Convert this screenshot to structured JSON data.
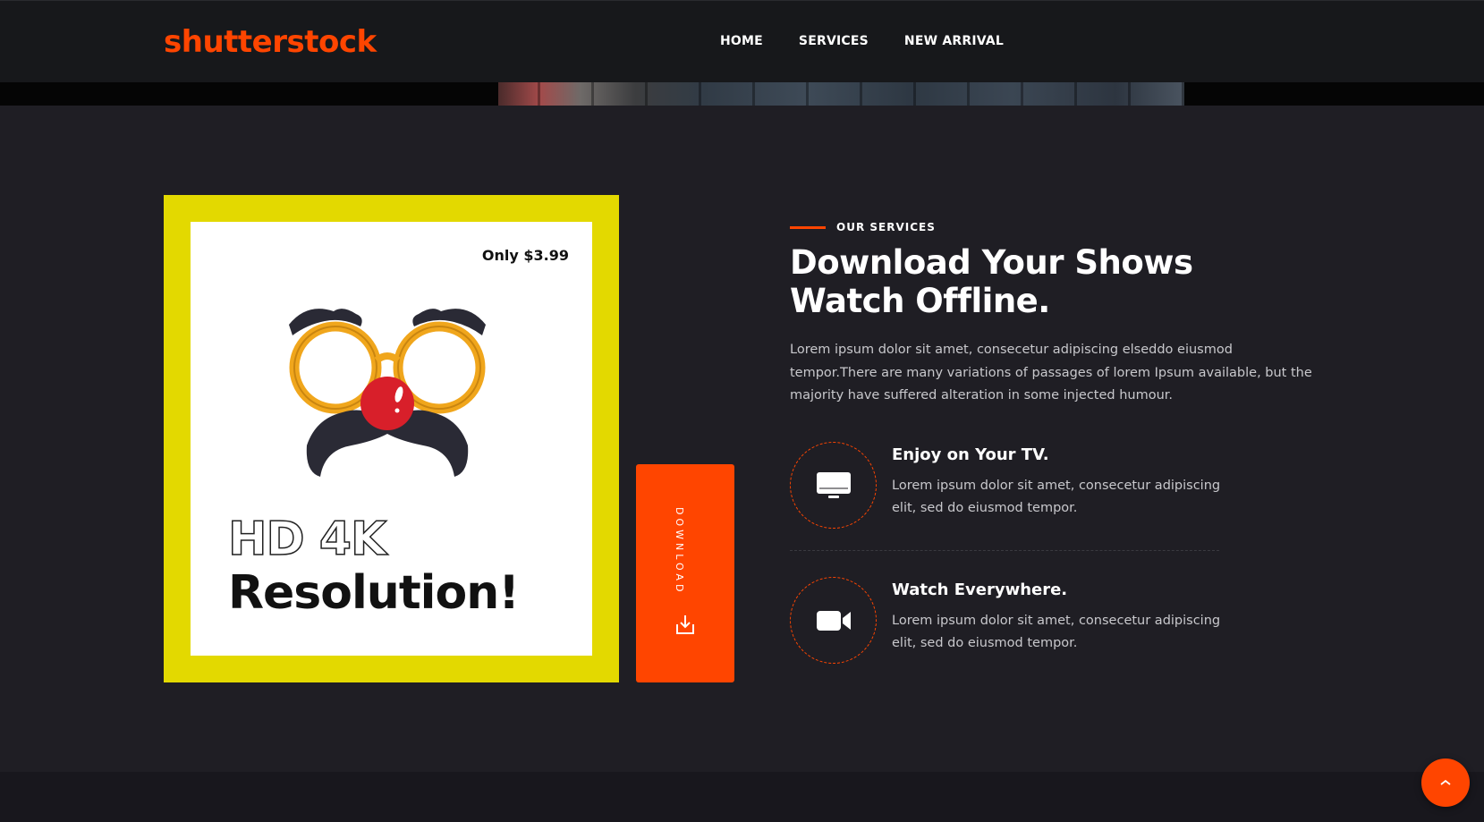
{
  "header": {
    "logo": "shutterstock",
    "nav": [
      {
        "label": "HOME"
      },
      {
        "label": "SERVICES"
      },
      {
        "label": "NEW ARRIVAL"
      }
    ]
  },
  "promo": {
    "price": "Only $3.99",
    "headline_outline": "HD 4K",
    "headline_solid": "Resolution!",
    "download_label": "DOWNLOAD"
  },
  "services": {
    "eyebrow": "OUR SERVICES",
    "title_line1": "Download Your Shows",
    "title_line2": "Watch Offline.",
    "description": "Lorem ipsum dolor sit amet, consecetur adipiscing elseddo eiusmod tempor.There are many variations of passages of lorem Ipsum available, but the majority have suffered alteration in some injected humour.",
    "features": [
      {
        "icon": "tv-icon",
        "title": "Enjoy on Your TV.",
        "text": "Lorem ipsum dolor sit amet, consecetur adipiscing elit, sed do eiusmod tempor."
      },
      {
        "icon": "video-camera-icon",
        "title": "Watch Everywhere.",
        "text": "Lorem ipsum dolor sit amet, consecetur adipiscing elit, sed do eiusmod tempor."
      }
    ]
  },
  "colors": {
    "accent": "#ff4500",
    "promo_frame": "#e3d900",
    "background": "#1f1e24",
    "header_bg": "#17181b"
  }
}
